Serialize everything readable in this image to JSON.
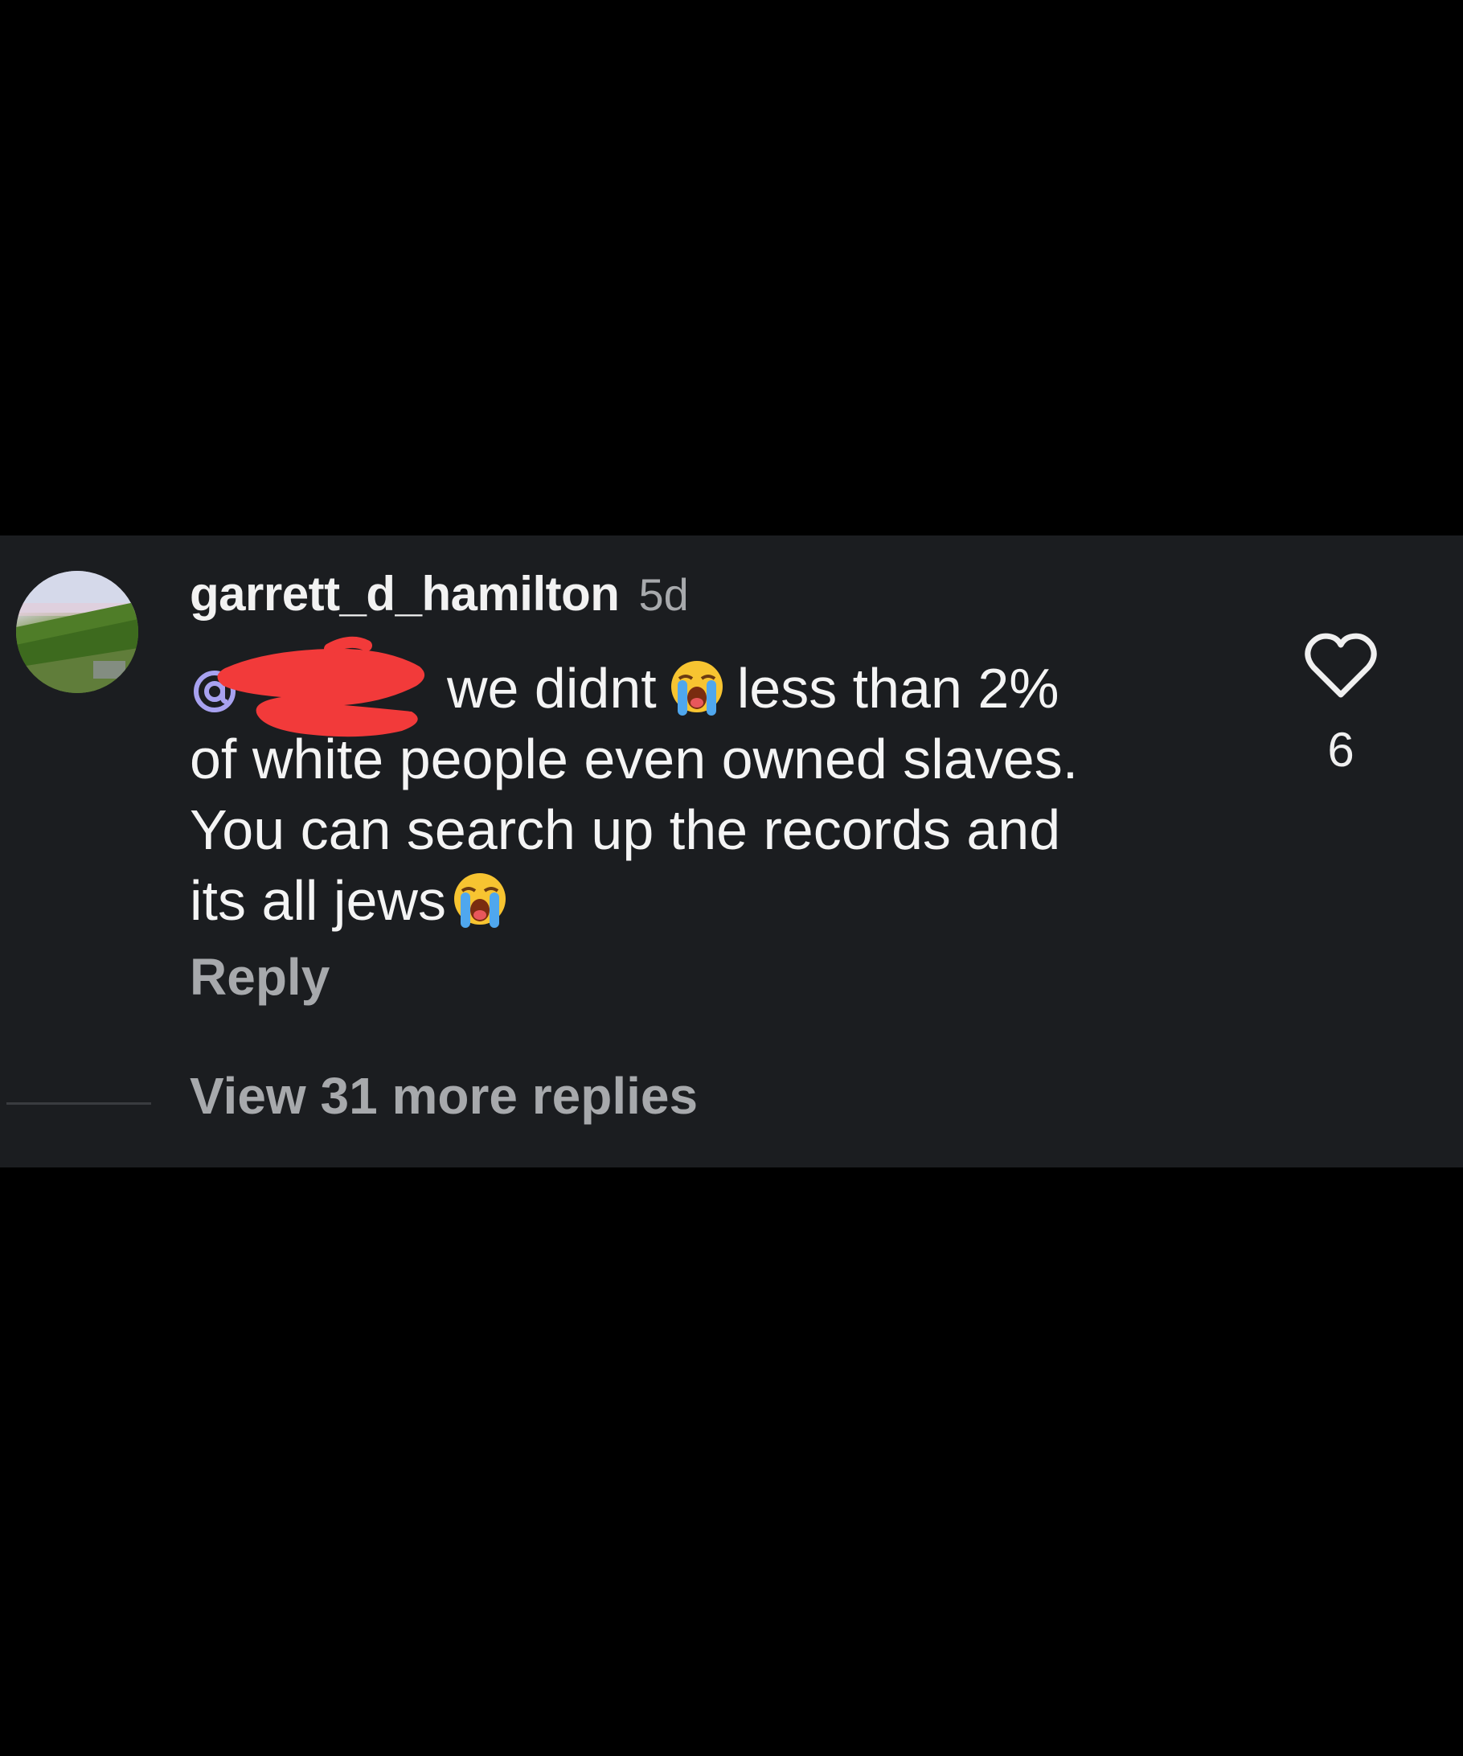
{
  "comment": {
    "username": "garrett_d_hamilton",
    "timestamp": "5d",
    "mention_prefix": "@",
    "line1_a": "we didnt",
    "line1_b": "less than 2%",
    "line2": "of white people even owned slaves.",
    "line3": "You can search up the records and",
    "line4": "its all jews",
    "emoji": "loudly-crying-face",
    "reply_label": "Reply",
    "like_count": "6",
    "view_replies_label": "View 31 more replies"
  },
  "colors": {
    "background": "#000000",
    "panel": "#1b1d20",
    "text_primary": "#f4f4f4",
    "text_secondary": "#a7a9ac",
    "mention": "#a8a2f0",
    "redaction": "#f23a3a"
  },
  "icons": {
    "like": "heart-outline-icon",
    "mention": "at-sign-icon"
  }
}
